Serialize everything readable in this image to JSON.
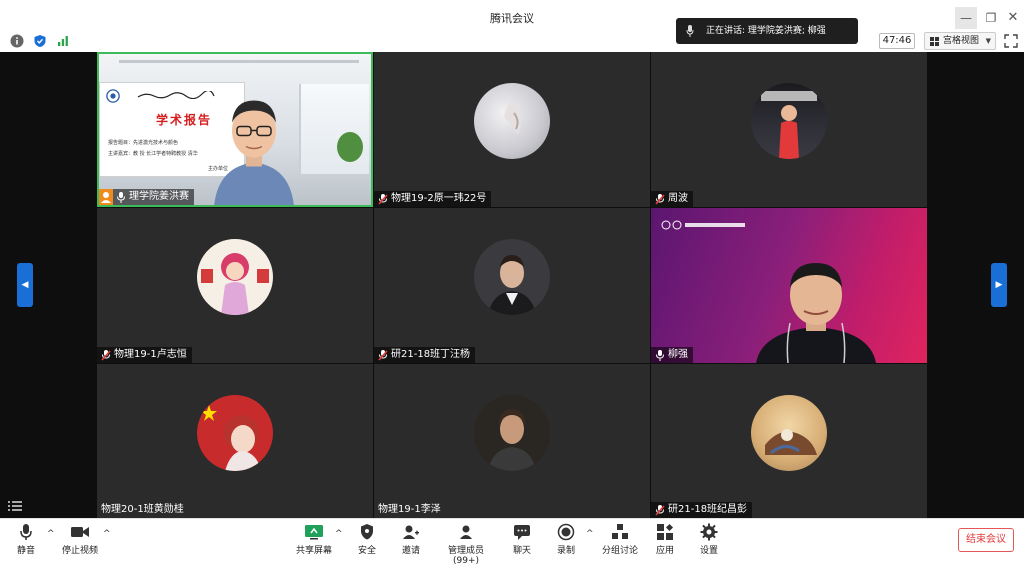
{
  "window": {
    "title": "腾讯会议",
    "speaking_toast": "正在讲话: 理学院姜洪赛; 柳强",
    "timer": "47:46",
    "view_button": "宫格视图"
  },
  "participants": [
    {
      "name": "理学院姜洪赛",
      "has_video": true,
      "muted": false,
      "host": true
    },
    {
      "name": "物理19-2原一玮22号",
      "has_video": false,
      "muted": true
    },
    {
      "name": "周波",
      "has_video": false,
      "muted": true
    },
    {
      "name": "物理19-1卢志恒",
      "has_video": false,
      "muted": true
    },
    {
      "name": "研21-18班丁汪杨",
      "has_video": false,
      "muted": true
    },
    {
      "name": "柳强",
      "has_video": true,
      "muted": false
    },
    {
      "name": "物理20-1班黄勋桂",
      "has_video": false,
      "muted": false
    },
    {
      "name": "物理19-1李泽",
      "has_video": false,
      "muted": false
    },
    {
      "name": "研21-18班纪昌彭",
      "has_video": false,
      "muted": true
    }
  ],
  "slide": {
    "title": "学术报告",
    "line1": "报告题目：先进激光技术与颜色",
    "line2": "主讲嘉宾：教  授  长江学者特聘教授  清华",
    "line3": "主办单位"
  },
  "toolbar": {
    "mute": "静音",
    "stop_video": "停止视频",
    "share": "共享屏幕",
    "security": "安全",
    "invite": "邀请",
    "manage": "管理成员(99+)",
    "chat": "聊天",
    "record": "录制",
    "breakout": "分组讨论",
    "apps": "应用",
    "settings": "设置",
    "end": "结束会议"
  },
  "colors": {
    "accent": "#1a6fd6",
    "end": "#e33b3b",
    "host_badge": "#f08c1e",
    "active_speaker": "#3dbb59"
  }
}
